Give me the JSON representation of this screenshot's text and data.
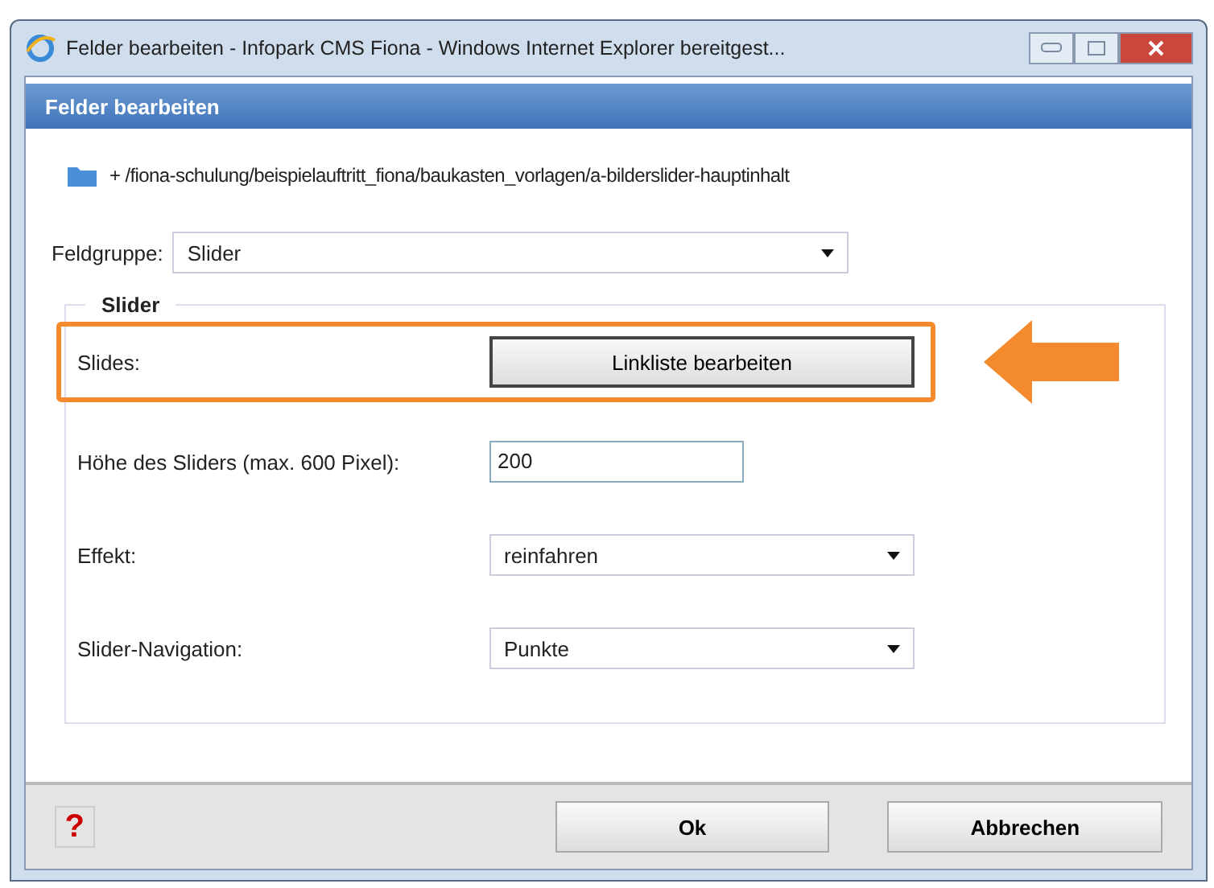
{
  "window": {
    "title": "Felder bearbeiten - Infopark CMS Fiona - Windows Internet Explorer bereitgest..."
  },
  "dialog": {
    "title": "Felder bearbeiten",
    "path": "+ /fiona-schulung/beispielauftritt_fiona/baukasten_vorlagen/a-bilderslider-hauptinhalt",
    "fieldgroup": {
      "label": "Feldgruppe:",
      "value": "Slider"
    },
    "fieldset": {
      "legend": "Slider",
      "fields": [
        {
          "kind": "button",
          "label": "Slides:",
          "value": "Linkliste bearbeiten",
          "highlighted": true
        },
        {
          "kind": "input",
          "label": "Höhe des Sliders (max. 600 Pixel):",
          "value": "200",
          "highlighted": false
        },
        {
          "kind": "select",
          "label": "Effekt:",
          "value": "reinfahren",
          "highlighted": false
        },
        {
          "kind": "select",
          "label": "Slider-Navigation:",
          "value": "Punkte",
          "highlighted": false
        }
      ]
    },
    "help": "?",
    "buttons": [
      "Ok",
      "Abbrechen"
    ]
  }
}
